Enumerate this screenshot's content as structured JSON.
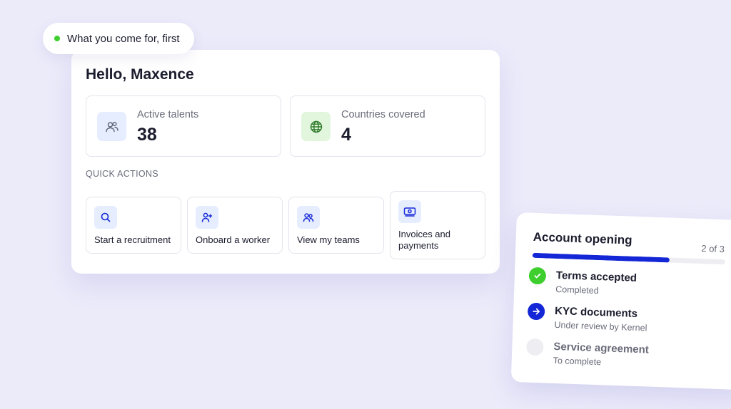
{
  "badge": {
    "text": "What you come for, first",
    "dot_color": "#3ecf2f"
  },
  "dashboard": {
    "greeting": "Hello, Maxence",
    "stats": [
      {
        "label": "Active talents",
        "value": "38",
        "icon": "users-icon",
        "icon_bg": "#e6edff"
      },
      {
        "label": "Countries covered",
        "value": "4",
        "icon": "globe-icon",
        "icon_bg": "#e2f6de"
      }
    ],
    "quick_actions_title": "QUICK ACTIONS",
    "quick_actions": [
      {
        "label": "Start a recruitment",
        "icon": "search-icon"
      },
      {
        "label": "Onboard a worker",
        "icon": "add-user-icon"
      },
      {
        "label": "View my teams",
        "icon": "team-icon"
      },
      {
        "label": "Invoices and payments",
        "icon": "payment-icon"
      }
    ]
  },
  "account_opening": {
    "title": "Account opening",
    "step_count": "2 of 3",
    "progress_fraction": 0.71,
    "accent": "#1427d6",
    "steps": [
      {
        "title": "Terms accepted",
        "subtitle": "Completed",
        "status": "completed",
        "color": "#3ecf2f"
      },
      {
        "title": "KYC documents",
        "subtitle": "Under review by Kernel",
        "status": "in-progress",
        "color": "#1427d6"
      },
      {
        "title": "Service agreement",
        "subtitle": "To complete",
        "status": "pending",
        "color": "#eeeef2"
      }
    ]
  }
}
